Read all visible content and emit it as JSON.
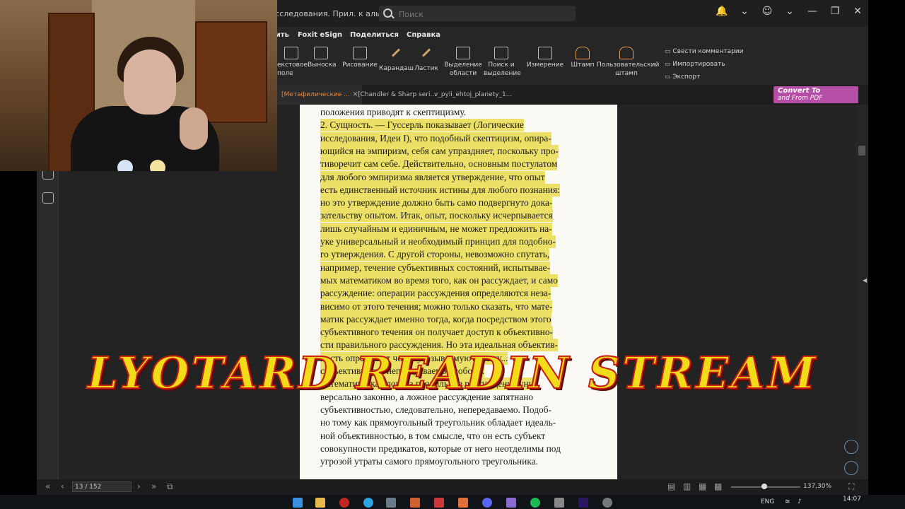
{
  "window": {
    "doc_title": "исследования. Прил. к альм) Жа...",
    "search_placeholder": "Поиск",
    "controls": [
      "🔔",
      "⌄",
      "☺",
      "⌄",
      "—",
      "❐",
      "✕"
    ]
  },
  "menu": [
    "Защитить",
    "Foxit eSign",
    "Поделиться",
    "Справка"
  ],
  "ribbon": {
    "left_fragment": "екстовое поле",
    "items": [
      "Выноска",
      "Рисование",
      "Карандаш",
      "Ластик",
      "Выделение области",
      "Поиск и выделение",
      "Измерение",
      "Штамп",
      "Пользовательский штамп"
    ],
    "right": [
      "Свести комментарии",
      "Импортировать",
      "Экспорт"
    ]
  },
  "tabs": [
    {
      "label": "[Метафилические ...",
      "active": true
    },
    {
      "label": "[Chandler & Sharp seri...",
      "active": false
    },
    {
      "label": "v_pyli_ehtoj_planety_1...",
      "active": false
    }
  ],
  "convert_pdf": {
    "line1": "Convert To",
    "line2": "and From PDF"
  },
  "page_lines": [
    {
      "text": "положения приводят к скептицизму.",
      "hl": false
    },
    {
      "text": "    2. Сущность. — Гуссерль показывает (Логические",
      "hl": true
    },
    {
      "text": "исследования, Идеи I), что подобный скептицизм, опира-",
      "hl": true
    },
    {
      "text": "ющийся на эмпиризм, себя сам упраздняет, поскольку про-",
      "hl": true
    },
    {
      "text": "тиворечит сам себе. Действительно, основным постулатом",
      "hl": true
    },
    {
      "text": "для любого эмпиризма является утверждение, что опыт",
      "hl": true
    },
    {
      "text": "есть единственный источник истины для любого познания:",
      "hl": true
    },
    {
      "text": "но это утверждение должно быть само подвергнуто дока-",
      "hl": true
    },
    {
      "text": "зательству опытом. Итак, опыт, поскольку исчерпывается",
      "hl": true
    },
    {
      "text": "лишь случайным и единичным, не может предложить на-",
      "hl": true
    },
    {
      "text": "уке универсальный и необходимый принцип для подобно-",
      "hl": true
    },
    {
      "text": "го утверждения. С другой стороны, невозможно спутать,",
      "hl": true
    },
    {
      "text": "например, течение субъективных состояний, испытывае-",
      "hl": true
    },
    {
      "text": "мых математиком во время того, как он рассуждает, и само",
      "hl": true
    },
    {
      "text": "рассуждение: операции рассуждения определяются неза-",
      "hl": true
    },
    {
      "text": "висимо от этого течения; можно только сказать, что мате-",
      "hl": true
    },
    {
      "text": "матик рассуждает именно тогда, когда посредством этого",
      "hl": true
    },
    {
      "text": "субъективного течения он получает доступ к объективно-",
      "hl": true
    },
    {
      "text": "сти правильного рассуждения. Но эта идеальная объектив-",
      "hl": true
    },
    {
      "text": "ность определяет четко указываемую истину...",
      "hl": true
    },
    {
      "text": "субъективности непередаваемой собой...",
      "hl": true
    },
    {
      "text": "математику, как логика правильное рассуждение уни-",
      "hl": true
    },
    {
      "text": "версально законно, а ложное рассуждение запятнано",
      "hl": false
    },
    {
      "text": "субъективностью, следовательно, непередаваемо. Подоб-",
      "hl": false
    },
    {
      "text": "но тому как прямоугольный треугольник обладает идеаль-",
      "hl": false
    },
    {
      "text": "ной объективностью, в том смысле, что он есть субъект",
      "hl": false
    },
    {
      "text": "совокупности предикатов, которые от него неотделимы под",
      "hl": false
    },
    {
      "text": "угрозой утраты самого прямоугольного треугольника.",
      "hl": false
    }
  ],
  "status": {
    "page_value": "13 / 152",
    "zoom": "137,30%"
  },
  "overlay_text": "LYOTARD READIN STREAM",
  "taskbar": {
    "lang": "ENG",
    "time": "14:07"
  }
}
